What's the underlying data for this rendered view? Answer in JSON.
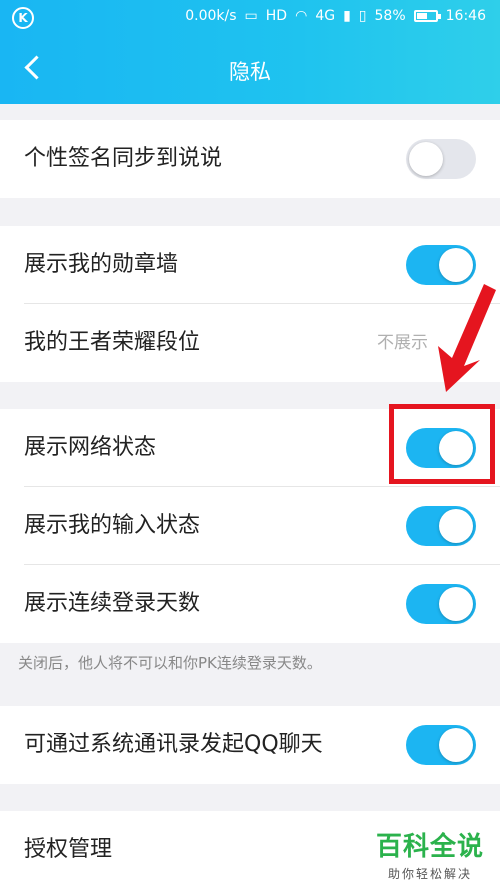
{
  "status_bar": {
    "network_speed": "0.00k/s",
    "battery_percent": "58%",
    "battery_level": 0.58,
    "time": "16:46",
    "hd_label": "HD",
    "g_label": "4G"
  },
  "nav": {
    "title": "隐私"
  },
  "rows": [
    {
      "label": "个性签名同步到说说",
      "toggle": false
    },
    {
      "label": "展示我的勋章墙",
      "toggle": true
    },
    {
      "label": "我的王者荣耀段位",
      "value": "不展示"
    },
    {
      "label": "展示网络状态",
      "toggle": true
    },
    {
      "label": "展示我的输入状态",
      "toggle": true
    },
    {
      "label": "展示连续登录天数",
      "toggle": true
    },
    {
      "label": "可通过系统通讯录发起QQ聊天",
      "toggle": true
    },
    {
      "label": "授权管理"
    }
  ],
  "hint": "关闭后，他人将不可以和你PK连续登录天数。",
  "annotation": {
    "arrow_color": "#e5151f",
    "box_color": "#e5151f"
  },
  "watermark": {
    "main": "百科全说",
    "sub": "助你轻松解决"
  },
  "colors": {
    "accent": "#1cb5f2",
    "header": "#1fc3ef"
  }
}
